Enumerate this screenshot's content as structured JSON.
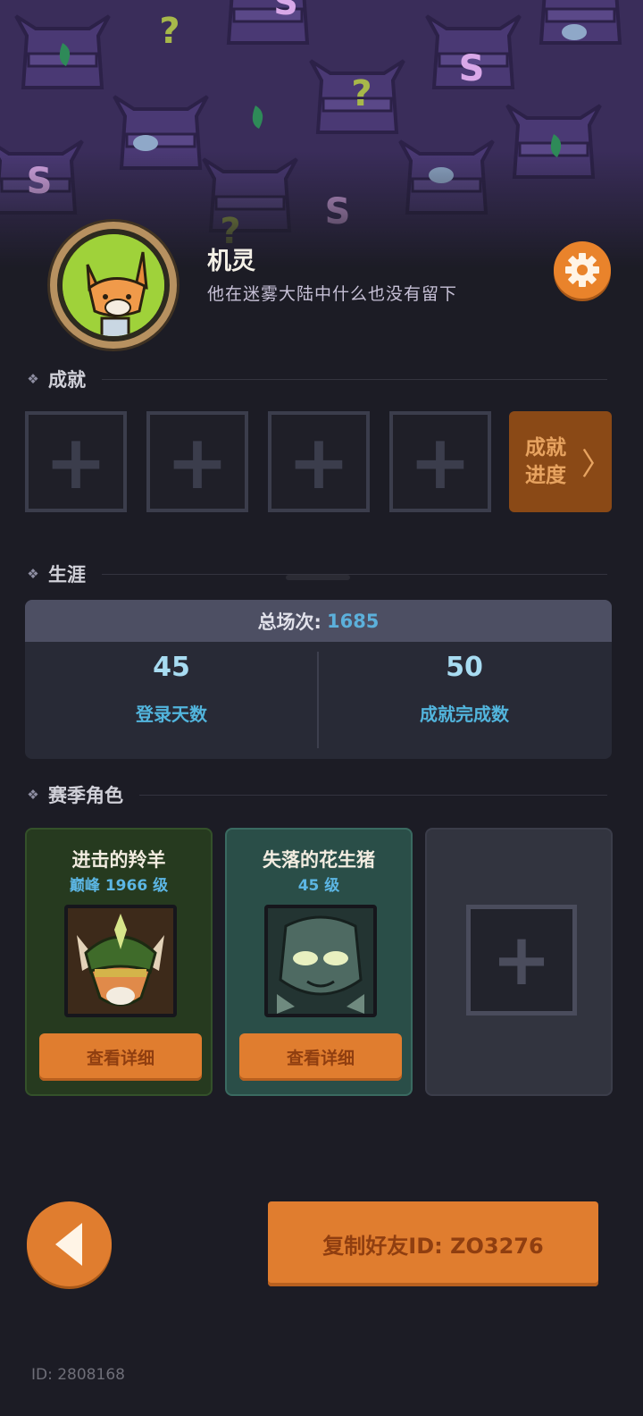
{
  "profile": {
    "name": "机灵",
    "bio": "他在迷雾大陆中什么也没有留下"
  },
  "achievements": {
    "title": "成就",
    "slots": [
      "+",
      "+",
      "+",
      "+"
    ],
    "progress_label_line1": "成就",
    "progress_label_line2": "进度",
    "progress_chevron": "〉"
  },
  "career": {
    "title": "生涯",
    "total_label": "总场次:",
    "total_value": "1685",
    "stats": [
      {
        "value": "45",
        "label": "登录天数"
      },
      {
        "value": "50",
        "label": "成就完成数"
      }
    ]
  },
  "season_heroes": {
    "title": "赛季角色",
    "heroes": [
      {
        "name": "进击的羚羊",
        "rank": "巅峰 1966 级",
        "button": "查看详细"
      },
      {
        "name": "失落的花生猪",
        "rank": "45 级",
        "button": "查看详细"
      }
    ],
    "empty_slot": "+"
  },
  "footer": {
    "copy_button": "复制好友ID: ZO3276",
    "user_id": "ID: 2808168"
  },
  "icons": {
    "settings": "gear-icon",
    "back": "back-arrow-icon",
    "section_marker": "diamond-icon"
  },
  "colors": {
    "accent": "#e07d2f",
    "background": "#1c1c25",
    "highlight_blue": "#5cb0db",
    "banner": "#3a2d5a"
  }
}
